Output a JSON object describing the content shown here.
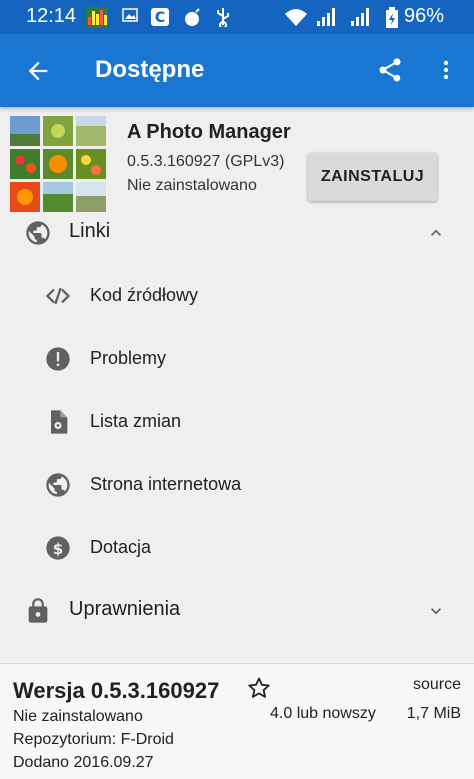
{
  "status_bar": {
    "time": "12:14",
    "battery": "96%"
  },
  "toolbar": {
    "title": "Dostępne"
  },
  "app": {
    "name": "A Photo Manager",
    "version": "0.5.3.160927 (GPLv3)",
    "status": "Nie zainstalowano",
    "install_label": "ZAINSTALUJ"
  },
  "links": {
    "header": "Linki",
    "items": [
      {
        "label": "Kod źródłowy",
        "icon": "code-icon"
      },
      {
        "label": "Problemy",
        "icon": "alert-icon"
      },
      {
        "label": "Lista zmian",
        "icon": "changelog-file-icon"
      },
      {
        "label": "Strona internetowa",
        "icon": "globe-icon"
      },
      {
        "label": "Dotacja",
        "icon": "dollar-icon"
      }
    ]
  },
  "permissions": {
    "header": "Uprawnienia"
  },
  "version_panel": {
    "title": "Wersja 0.5.3.160927",
    "source": "source",
    "status": "Nie zainstalowano",
    "requirement": "4.0 lub nowszy",
    "size": "1,7 MiB",
    "repository": "Repozytorium: F-Droid",
    "added": "Dodano 2016.09.27"
  },
  "colors": {
    "status_bar": "#1565c0",
    "toolbar": "#1976d2",
    "icon_gray": "#616161",
    "background": "#efefef"
  }
}
